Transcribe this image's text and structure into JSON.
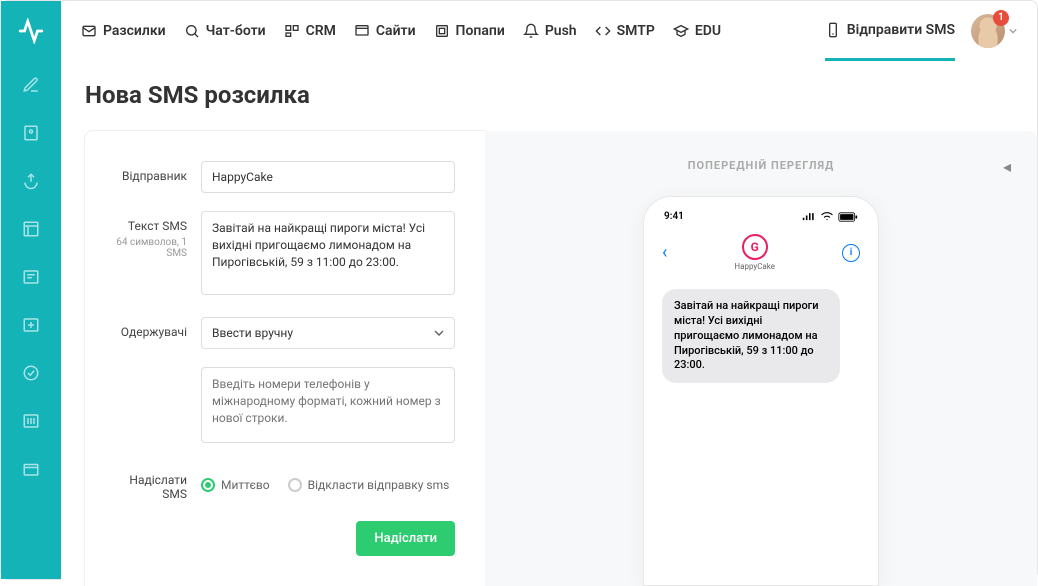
{
  "nav": {
    "items": [
      {
        "label": "Разсилки"
      },
      {
        "label": "Чат-боти"
      },
      {
        "label": "CRM"
      },
      {
        "label": "Сайти"
      },
      {
        "label": "Попапи"
      },
      {
        "label": "Push"
      },
      {
        "label": "SMTP"
      },
      {
        "label": "EDU"
      }
    ],
    "send_sms": "Відправити SMS",
    "badge": "1"
  },
  "page": {
    "title": "Нова SMS розсилка"
  },
  "form": {
    "sender_label": "Відправник",
    "sender_value": "HappyCake",
    "text_label": "Текст SMS",
    "text_sub": "64 символов, 1 SMS",
    "text_value": "Завітай на найкращі пироги міста! Усі вихідні пригощаємо лимонадом на Пирогівській, 59 з 11:00 до 23:00.",
    "recipients_label": "Одержувачі",
    "recipients_select": "Ввести вручну",
    "phones_placeholder": "Введіть номери телефонів у міжнародному форматі, кожний номер з нової строки.",
    "send_when_label": "Надіслати SMS",
    "radio_now": "Миттєво",
    "radio_later": "Відкласти відправку sms",
    "submit": "Надіслати"
  },
  "preview": {
    "title": "Попередній перегляд",
    "time": "9:41",
    "sender_name": "HappyCake",
    "message": "Завітай на найкращі пироги міста! Усі вихідні пригощаємо лимонадом на Пирогівській, 59 з 11:00 до 23:00."
  }
}
